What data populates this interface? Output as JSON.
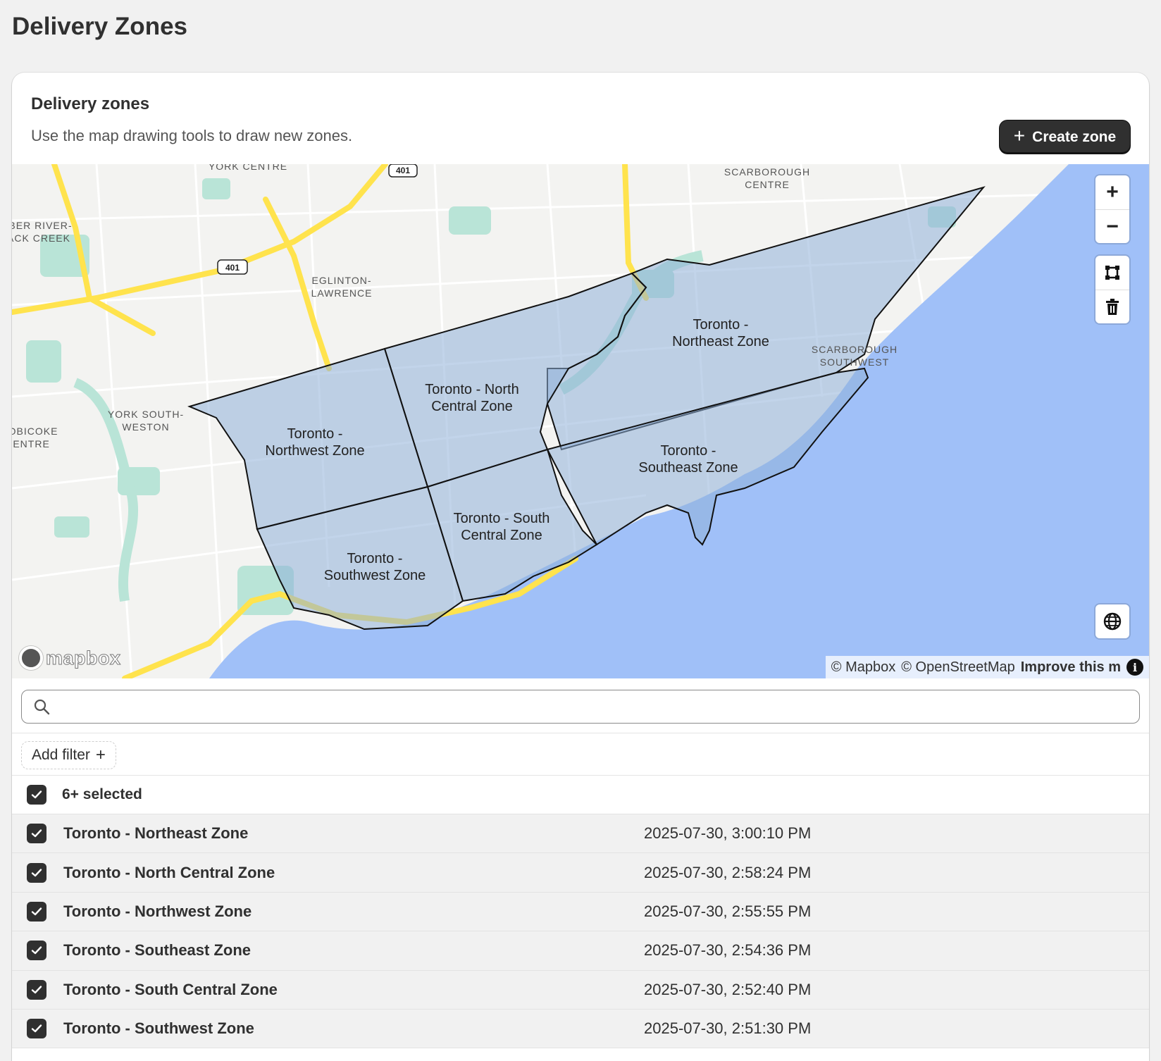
{
  "page": {
    "title": "Delivery Zones"
  },
  "card": {
    "title": "Delivery zones",
    "subtitle": "Use the map drawing tools to draw new zones.",
    "create_button": "Create zone"
  },
  "map": {
    "zone_fill": "#8fb0d8",
    "water": "#a0c0f8",
    "park": "#b9e4d7",
    "highway": "#ffe34d",
    "zones": [
      {
        "line1": "Toronto -",
        "line2": "Northeast Zone"
      },
      {
        "line1": "Toronto - North",
        "line2": "Central Zone"
      },
      {
        "line1": "Toronto -",
        "line2": "Northwest Zone"
      },
      {
        "line1": "Toronto -",
        "line2": "Southeast Zone"
      },
      {
        "line1": "Toronto - South",
        "line2": "Central Zone"
      },
      {
        "line1": "Toronto -",
        "line2": "Southwest Zone"
      }
    ],
    "place_labels": {
      "york_centre": "YORK CENTRE",
      "scarborough_centre_1": "SCARBOROUGH",
      "scarborough_centre_2": "CENTRE",
      "humber_1": "IBER RIVER-",
      "humber_2": "ACK CREEK",
      "eglinton_1": "EGLINTON-",
      "eglinton_2": "LAWRENCE",
      "york_south_1": "YORK SOUTH-",
      "york_south_2": "WESTON",
      "etobicoke_1": "OBICOKE",
      "etobicoke_2": "CENTRE",
      "scarborough_sw_1": "SCARBOROUGH",
      "scarborough_sw_2": "SOUTHWEST",
      "shield_401_a": "401",
      "shield_401_b": "401"
    },
    "controls": {
      "zoom_in": "+",
      "zoom_out": "−"
    },
    "attribution": {
      "mapbox": "© Mapbox",
      "osm": "© OpenStreetMap",
      "improve": "Improve this m",
      "info": "i"
    },
    "logo_text": "mapbox"
  },
  "search": {
    "placeholder": ""
  },
  "filter": {
    "add_label": "Add filter"
  },
  "selection": {
    "label": "6+ selected"
  },
  "zones_table": {
    "rows": [
      {
        "name": "Toronto - Northeast Zone",
        "date": "2025-07-30, 3:00:10 PM"
      },
      {
        "name": "Toronto - North Central Zone",
        "date": "2025-07-30, 2:58:24 PM"
      },
      {
        "name": "Toronto - Northwest Zone",
        "date": "2025-07-30, 2:55:55 PM"
      },
      {
        "name": "Toronto - Southeast Zone",
        "date": "2025-07-30, 2:54:36 PM"
      },
      {
        "name": "Toronto - South Central Zone",
        "date": "2025-07-30, 2:52:40 PM"
      },
      {
        "name": "Toronto - Southwest Zone",
        "date": "2025-07-30, 2:51:30 PM"
      }
    ]
  }
}
